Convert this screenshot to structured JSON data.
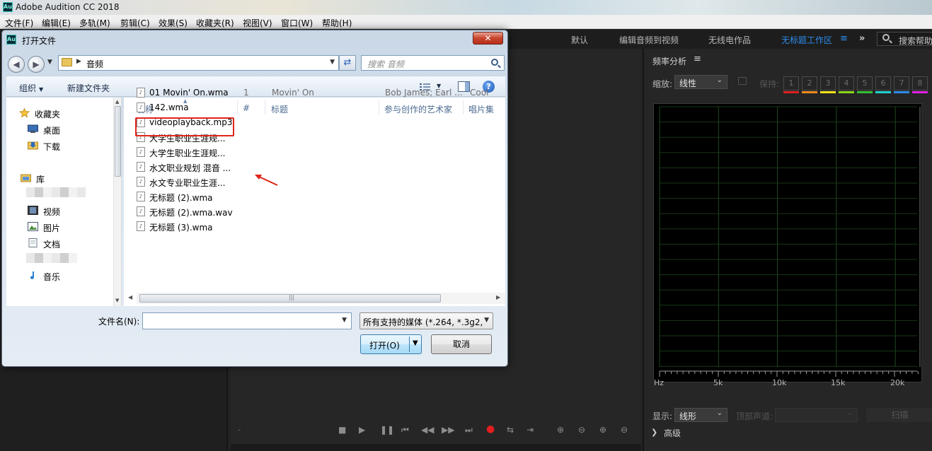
{
  "app": {
    "title": "Adobe Audition CC 2018",
    "logo": "Au"
  },
  "menu": [
    "文件(F)",
    "编辑(E)",
    "多轨(M)",
    "剪辑(C)",
    "效果(S)",
    "收藏夹(R)",
    "视图(V)",
    "窗口(W)",
    "帮助(H)"
  ],
  "workspaces": {
    "items": [
      "默认",
      "编辑音频到视频",
      "无线电作品",
      "无标题工作区"
    ],
    "active_index": 3,
    "menu_icon": "hamburger-icon",
    "more_icon": "double-chevron-right-icon",
    "help_search_placeholder": "搜索帮助"
  },
  "dialog": {
    "title": "打开文件",
    "close_label": "✕",
    "address": {
      "crumb": "音频"
    },
    "search_placeholder": "搜索 音频",
    "toolbar": {
      "organize": "组织",
      "new_folder": "新建文件夹",
      "help": "?"
    },
    "nav": {
      "favorites": "收藏夹",
      "desktop": "桌面",
      "downloads": "下载",
      "libraries": "库",
      "videos": "视频",
      "pictures": "图片",
      "documents": "文档",
      "music": "音乐"
    },
    "columns": {
      "name": "名称",
      "number": "#",
      "title": "标题",
      "artist": "参与创作的艺术家",
      "album": "唱片集"
    },
    "files": [
      {
        "name": "01 Movin' On.wma",
        "number": "1",
        "title": "Movin' On",
        "artist": "Bob James; Earl ...",
        "album": "Cool"
      },
      {
        "name": "142.wma"
      },
      {
        "name": "videoplayback.mp3"
      },
      {
        "name": "大学生职业生涯规..."
      },
      {
        "name": "大学生职业生涯规..."
      },
      {
        "name": "水文职业规划 混音 ..."
      },
      {
        "name": "水文专业职业生涯..."
      },
      {
        "name": "无标题 (2).wma"
      },
      {
        "name": "无标题 (2).wma.wav"
      },
      {
        "name": "无标题 (3).wma"
      }
    ],
    "filename_label": "文件名(N):",
    "filename_value": "",
    "filetype": "所有支持的媒体 (*.264, *.3g2, ",
    "open_label": "打开(O)",
    "cancel_label": "取消",
    "annotation_color": "#e0251b"
  },
  "right_panel": {
    "title": "频率分析",
    "scale_label": "缩放:",
    "scale_value": "线性",
    "hold_label": "保持:",
    "hold_buttons": [
      "1",
      "2",
      "3",
      "4",
      "5",
      "6",
      "7",
      "8"
    ],
    "hold_colors": [
      "#e02020",
      "#f08a1e",
      "#f2e21a",
      "#8ad61d",
      "#34c034",
      "#22d0d0",
      "#2f8ae8",
      "#e020e0"
    ],
    "x_ticks": [
      "Hz",
      "5k",
      "10k",
      "15k",
      "20k"
    ],
    "display_label": "显示:",
    "display_value": "线形",
    "channel_label": "顶部声道:",
    "scan_label": "扫描",
    "advanced_label": "高级"
  },
  "transport": {
    "buttons": [
      "stop-icon",
      "play-icon",
      "pause-icon",
      "skip-start-icon",
      "rewind-icon",
      "fast-forward-icon",
      "skip-end-icon",
      "record-icon",
      "loop-icon",
      "skip-icon",
      "zoom-in-amplitude-icon",
      "zoom-out-amplitude-icon",
      "zoom-in-time-icon",
      "zoom-out-time-icon"
    ]
  }
}
